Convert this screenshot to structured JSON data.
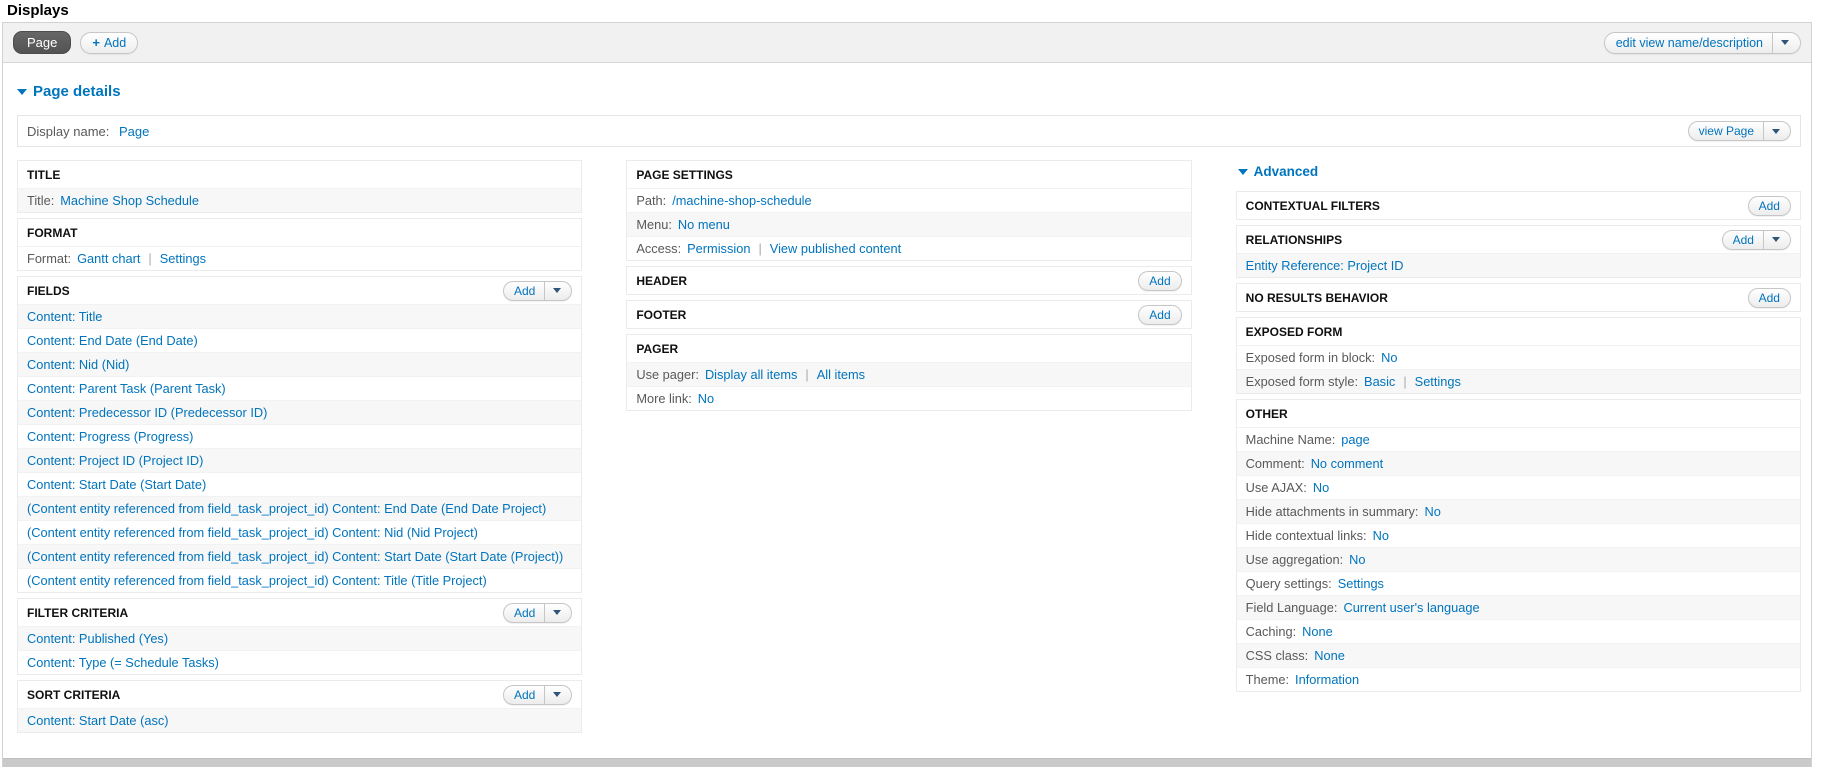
{
  "colors": {
    "link": "#0074bd",
    "active_display_bg": "#595959",
    "toolbar_bg": "#f1f1f1",
    "stripe": "#f7f7f7"
  },
  "icons": {
    "plus": "+",
    "dropdown_arrow": "triangle-down",
    "collapse_arrow": "triangle-down"
  },
  "ui": {
    "separator": "|",
    "add_label": "Add"
  },
  "header": {
    "title": "Displays"
  },
  "toolbar": {
    "active_display": "Page",
    "add_display_label": "Add",
    "edit_view_label": "edit view name/description"
  },
  "details": {
    "heading": "Page details",
    "display_name_label": "Display name:",
    "display_name_value": "Page",
    "view_button_label": "view Page"
  },
  "left": {
    "title": {
      "header": "TITLE",
      "label": "Title:",
      "value": "Machine Shop Schedule"
    },
    "format": {
      "header": "FORMAT",
      "label": "Format:",
      "link1": "Gantt chart",
      "link2": "Settings"
    },
    "fields": {
      "header": "FIELDS",
      "rows": [
        "Content: Title",
        "Content: End Date (End Date)",
        "Content: Nid (Nid)",
        "Content: Parent Task (Parent Task)",
        "Content: Predecessor ID (Predecessor ID)",
        "Content: Progress (Progress)",
        "Content: Project ID (Project ID)",
        "Content: Start Date (Start Date)",
        "(Content entity referenced from field_task_project_id) Content: End Date (End Date Project)",
        "(Content entity referenced from field_task_project_id) Content: Nid (Nid Project)",
        "(Content entity referenced from field_task_project_id) Content: Start Date (Start Date (Project))",
        "(Content entity referenced from field_task_project_id) Content: Title (Title Project)"
      ]
    },
    "filters": {
      "header": "FILTER CRITERIA",
      "rows": [
        "Content: Published (Yes)",
        "Content: Type (= Schedule Tasks)"
      ]
    },
    "sorts": {
      "header": "SORT CRITERIA",
      "rows": [
        "Content: Start Date (asc)"
      ]
    }
  },
  "middle": {
    "page_settings": {
      "header": "PAGE SETTINGS",
      "path_label": "Path:",
      "path_value": "/machine-shop-schedule",
      "menu_label": "Menu:",
      "menu_value": "No menu",
      "access_label": "Access:",
      "access_value1": "Permission",
      "access_value2": "View published content"
    },
    "header_bucket": "HEADER",
    "footer_bucket": "FOOTER",
    "pager": {
      "header": "PAGER",
      "use_pager_label": "Use pager:",
      "use_pager_value1": "Display all items",
      "use_pager_value2": "All items",
      "more_link_label": "More link:",
      "more_link_value": "No"
    }
  },
  "right": {
    "advanced_label": "Advanced",
    "contextual_header": "CONTEXTUAL FILTERS",
    "relationships": {
      "header": "RELATIONSHIPS",
      "row": "Entity Reference: Project ID"
    },
    "no_results_header": "NO RESULTS BEHAVIOR",
    "exposed": {
      "header": "EXPOSED FORM",
      "block_label": "Exposed form in block:",
      "block_value": "No",
      "style_label": "Exposed form style:",
      "style_value1": "Basic",
      "style_value2": "Settings"
    },
    "other": {
      "header": "OTHER",
      "rows": [
        {
          "label": "Machine Name:",
          "value": "page"
        },
        {
          "label": "Comment:",
          "value": "No comment"
        },
        {
          "label": "Use AJAX:",
          "value": "No"
        },
        {
          "label": "Hide attachments in summary:",
          "value": "No"
        },
        {
          "label": "Hide contextual links:",
          "value": "No"
        },
        {
          "label": "Use aggregation:",
          "value": "No"
        },
        {
          "label": "Query settings:",
          "value": "Settings"
        },
        {
          "label": "Field Language:",
          "value": "Current user's language"
        },
        {
          "label": "Caching:",
          "value": "None"
        },
        {
          "label": "CSS class:",
          "value": "None"
        },
        {
          "label": "Theme:",
          "value": "Information"
        }
      ]
    }
  }
}
